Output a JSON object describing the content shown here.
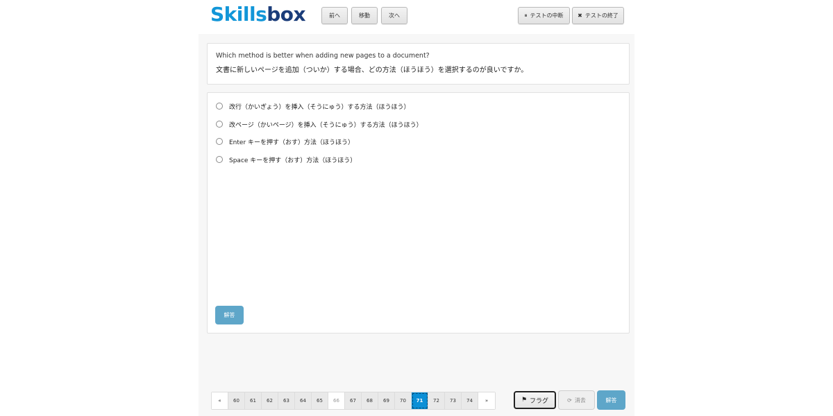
{
  "header": {
    "logo_part1": "Skills",
    "logo_part2": "box",
    "prev_label": "前へ",
    "move_label": "移動",
    "next_label": "次へ",
    "pause_icon": "⏸",
    "pause_label": "テストの中断",
    "end_icon": "✖",
    "end_label": "テストの終了"
  },
  "question": {
    "english": "Which method is better when adding new pages to a document?",
    "japanese": "文書に新しいページを追加（ついか）する場合、どの方法（ほうほう）を選択するのが良いですか。"
  },
  "options": [
    "改行（かいぎょう）を挿入（そうにゅう）する方法（ほうほう）",
    "改ページ（かいページ）を挿入（そうにゅう）する方法（ほうほう）",
    "Enter キーを押す（おす）方法（ほうほう）",
    "Space キーを押す（おす）方法（ほうほう）"
  ],
  "answer_label": "解答",
  "pagination": {
    "first": "«",
    "pages": [
      "60",
      "61",
      "62",
      "63",
      "64",
      "65",
      "66",
      "67",
      "68",
      "69",
      "70",
      "71",
      "72",
      "73",
      "74"
    ],
    "disabled_page": "66",
    "current_page": "71",
    "last": "»"
  },
  "footer": {
    "flag_icon": "⚑",
    "flag_label": "フラグ",
    "clear_icon": "⟳",
    "clear_label": "消去",
    "answer_label": "解答"
  },
  "colors": {
    "logo_light": "#1296d8",
    "logo_dark": "#1b3d7a",
    "answer_button": "#5ea6c9",
    "active_page": "#0b8fd6"
  }
}
